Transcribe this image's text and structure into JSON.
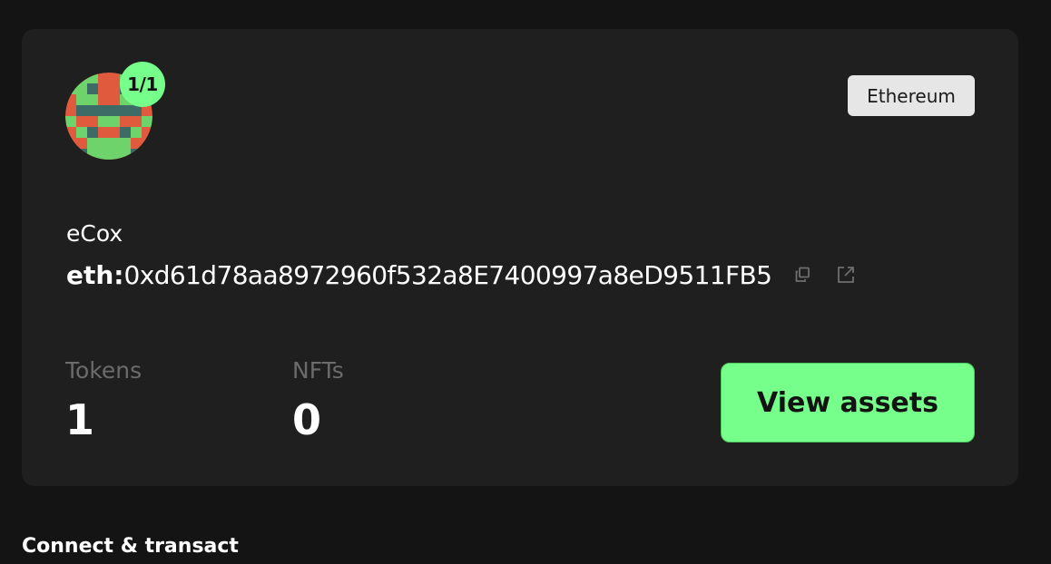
{
  "safe": {
    "name": "eCox",
    "address_prefix": "eth:",
    "address": "0xd61d78aa8972960f532a8E7400997a8eD9511FB5",
    "threshold": "1/1",
    "network": "Ethereum"
  },
  "stats": {
    "tokens_label": "Tokens",
    "tokens_value": "1",
    "nfts_label": "NFTs",
    "nfts_value": "0"
  },
  "actions": {
    "view_assets_label": "View assets",
    "copy_icon": "copy-icon",
    "explorer_icon": "external-link-icon"
  },
  "sections": {
    "connect_title": "Connect & transact"
  },
  "colors": {
    "accent": "#76ff8b",
    "card_bg": "#1f1f1f",
    "page_bg": "#141414",
    "identicon_red": "#e05a3e",
    "identicon_green": "#6dd36a",
    "identicon_teal": "#3d6b66"
  }
}
